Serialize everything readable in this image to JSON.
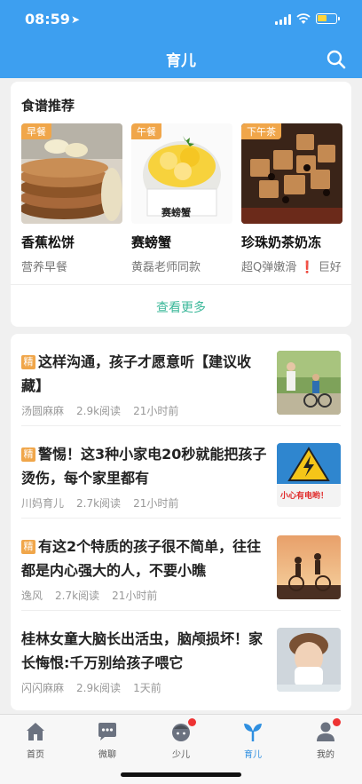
{
  "status_bar": {
    "time": "08:59"
  },
  "header": {
    "title": "育儿"
  },
  "recipes": {
    "section_title": "食谱推荐",
    "items": [
      {
        "tag": "早餐",
        "name": "香蕉松饼",
        "desc": "营养早餐"
      },
      {
        "tag": "午餐",
        "name": "赛螃蟹",
        "desc": "黄磊老师同款",
        "img_text": "赛螃蟹"
      },
      {
        "tag": "下午茶",
        "name": "珍珠奶茶奶冻",
        "desc_a": "超Q弹嫩滑",
        "desc_b": "巨好",
        "desc_mark": "❗"
      }
    ],
    "see_more": "查看更多"
  },
  "feed": {
    "badge": "精",
    "articles": [
      {
        "featured": true,
        "title": "这样沟通，孩子才愿意听【建议收藏】",
        "author": "汤圆麻麻",
        "reads": "2.9k阅读",
        "time": "21小时前"
      },
      {
        "featured": true,
        "title": "警惕！这3种小家电20秒就能把孩子烫伤，每个家里都有",
        "author": "川妈育儿",
        "reads": "2.7k阅读",
        "time": "21小时前",
        "img_text": "小心有电哟！"
      },
      {
        "featured": true,
        "title": "有这2个特质的孩子很不简单，往往都是内心强大的人，不要小瞧",
        "author": "逸风",
        "reads": "2.7k阅读",
        "time": "21小时前"
      },
      {
        "featured": false,
        "title": "桂林女童大脑长出活虫，脑颅损坏！家长悔恨:千万别给孩子喂它",
        "author": "闪闪麻麻",
        "reads": "2.9k阅读",
        "time": "1天前"
      }
    ]
  },
  "tabbar": {
    "tabs": [
      {
        "label": "首页",
        "icon": "home-icon"
      },
      {
        "label": "微聊",
        "icon": "chat-icon"
      },
      {
        "label": "少儿",
        "icon": "kid-icon"
      },
      {
        "label": "育儿",
        "icon": "sprout-icon"
      },
      {
        "label": "我的",
        "icon": "profile-icon"
      }
    ]
  },
  "colors": {
    "header": "#3d9ff0",
    "tag": "#f0a64a",
    "active": "#2f8fe0",
    "see_more": "#3cb89a"
  }
}
